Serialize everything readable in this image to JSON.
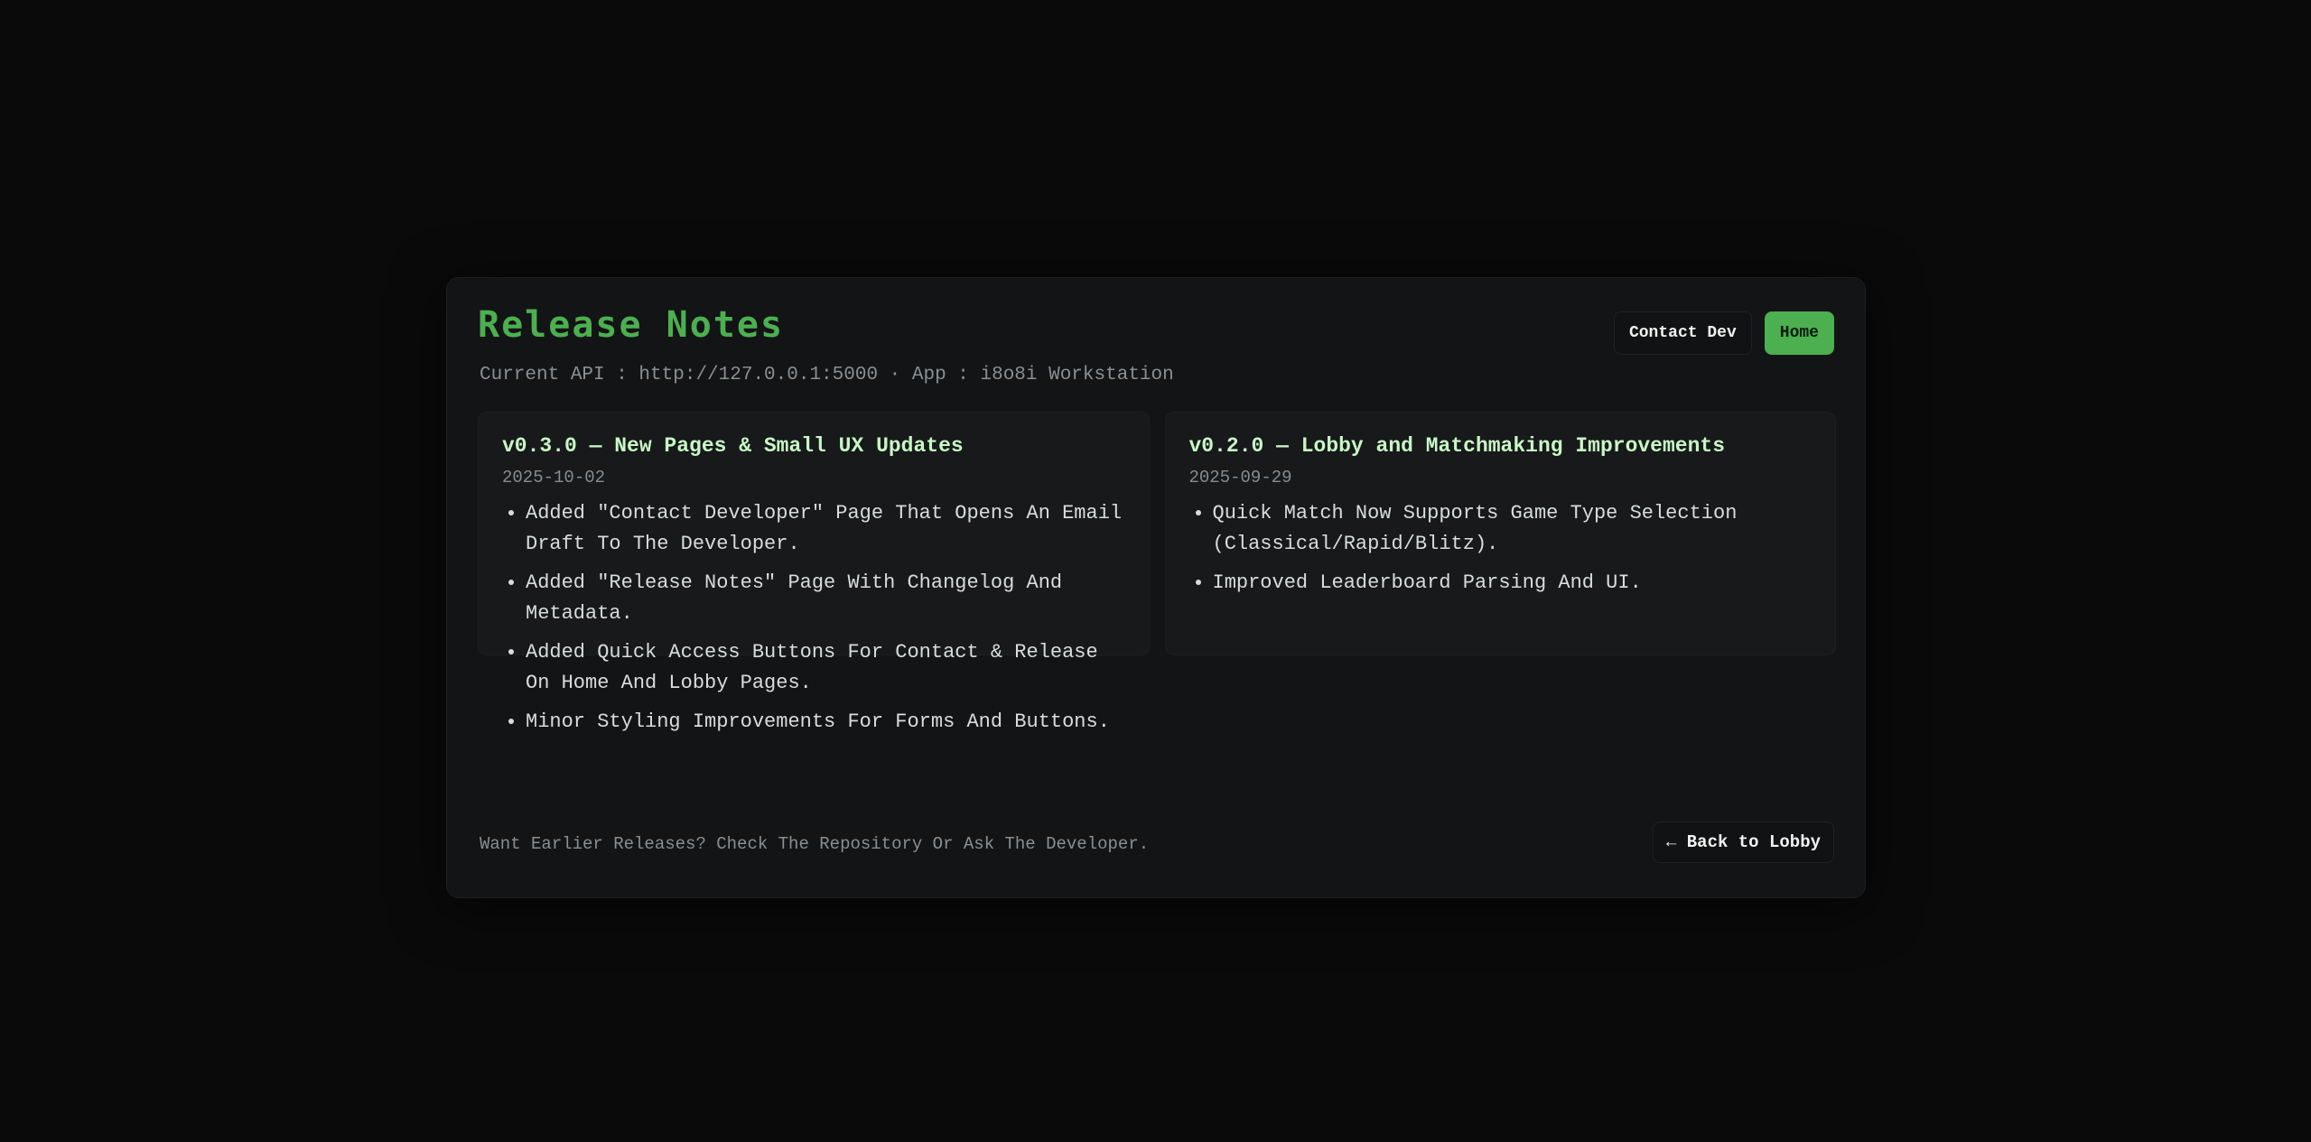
{
  "header": {
    "title": "Release Notes",
    "meta": "Current API : http://127.0.0.1:5000 · App : i8o8i Workstation",
    "contact_label": "Contact Dev",
    "home_label": "Home"
  },
  "releases": [
    {
      "title": "v0.3.0 — New Pages & Small UX Updates",
      "date": "2025-10-02",
      "items": [
        "Added \"Contact Developer\" Page That Opens An Email Draft To The Developer.",
        "Added \"Release Notes\" Page With Changelog And Metadata.",
        "Added Quick Access Buttons For Contact & Release On Home And Lobby Pages.",
        "Minor Styling Improvements For Forms And Buttons."
      ]
    },
    {
      "title": "v0.2.0 — Lobby and Matchmaking Improvements",
      "date": "2025-09-29",
      "items": [
        "Quick Match Now Supports Game Type Selection (Classical/Rapid/Blitz).",
        "Improved Leaderboard Parsing And UI."
      ]
    }
  ],
  "footer": {
    "text": "Want Earlier Releases? Check The Repository Or Ask The Developer.",
    "back_label": "← Back to Lobby"
  },
  "colors": {
    "accent": "#4caf50",
    "background": "#0a0a0a",
    "panel": "#131415"
  }
}
